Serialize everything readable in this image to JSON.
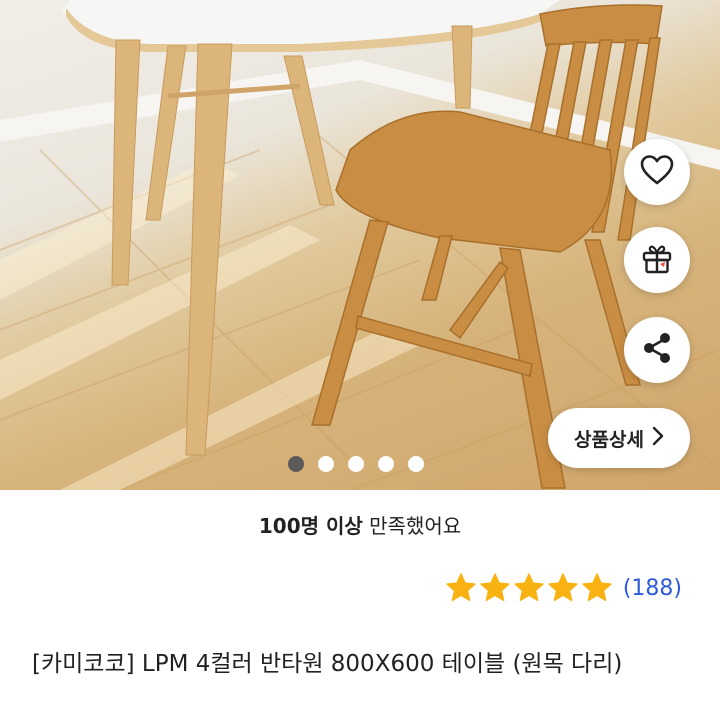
{
  "colors": {
    "star": "#f8b313",
    "review_link": "#2e5bd9",
    "dot_active": "#5b5b5b",
    "dot_inactive": "#ffffff"
  },
  "actions": {
    "wish_icon": "heart-icon",
    "gift_icon": "gift-icon",
    "share_icon": "share-icon",
    "detail_label": "상품상세",
    "detail_icon": "chevron-right-icon"
  },
  "carousel": {
    "total": 5,
    "active_index": 0
  },
  "satisfaction": {
    "bold": "100명 이상",
    "rest": " 만족했어요"
  },
  "rating": {
    "stars": 5,
    "count_text": "(188)"
  },
  "product": {
    "title": "[카미코코] LPM 4컬러 반타원 800X600 테이블 (원목 다리)"
  }
}
